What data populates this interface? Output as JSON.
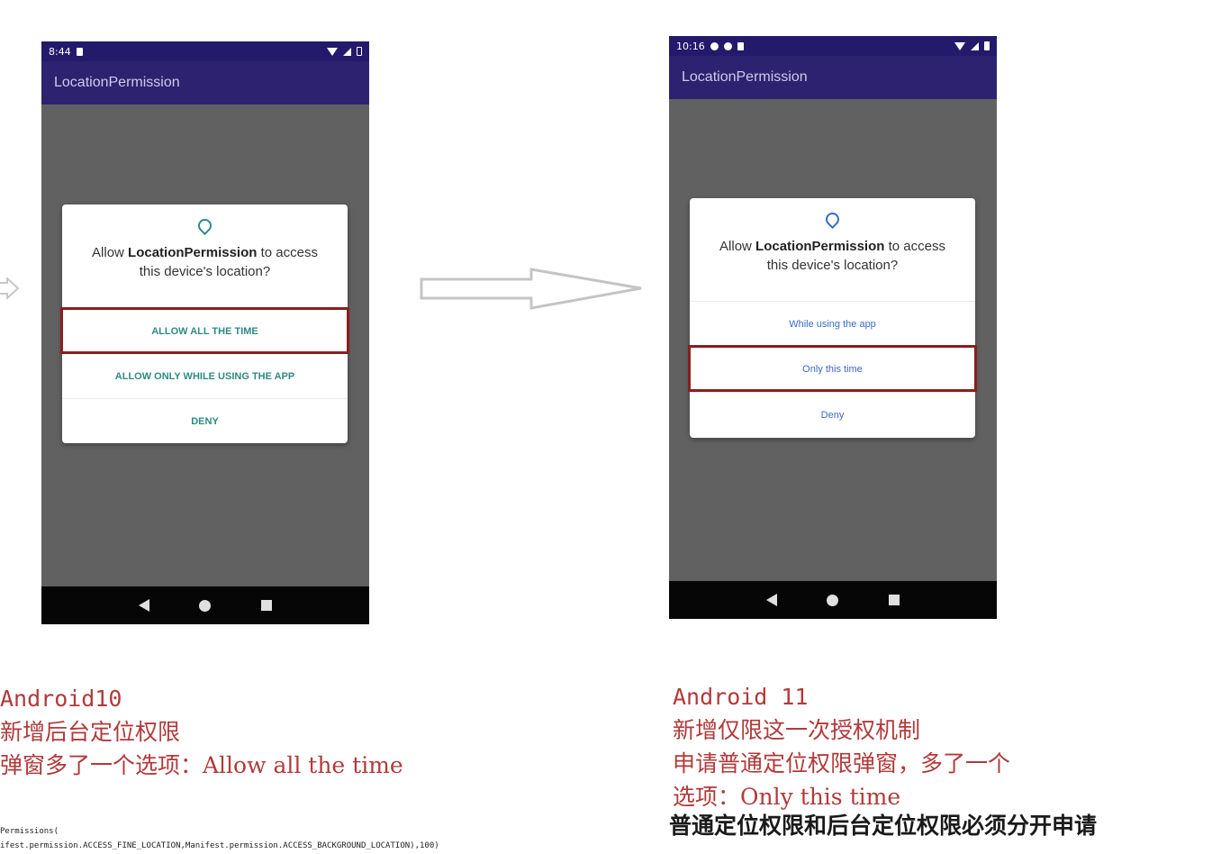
{
  "left_phone": {
    "status_time": "8:44",
    "app_title": "LocationPermission",
    "dialog": {
      "prefix": "Allow ",
      "app_name": "LocationPermission",
      "suffix": " to access this device's location?",
      "options": [
        "ALLOW ALL THE TIME",
        "ALLOW ONLY WHILE USING THE APP",
        "DENY"
      ],
      "highlighted_option": "ALLOW ALL THE TIME"
    }
  },
  "right_phone": {
    "status_time": "10:16",
    "app_title": "LocationPermission",
    "dialog": {
      "prefix": "Allow ",
      "app_name": "LocationPermission",
      "suffix": " to access this device's location?",
      "options": [
        "While using the app",
        "Only this time",
        "Deny"
      ],
      "highlighted_option": "Only this time"
    }
  },
  "captions": {
    "left": {
      "title": "Android10",
      "line1": "新增后台定位权限",
      "line2": "弹窗多了一个选项：Allow all the time"
    },
    "right": {
      "title": "Android 11",
      "line1": "新增仅限这一次授权机制",
      "line2": "申请普通定位权限弹窗，多了一个",
      "line3": "选项：Only this time",
      "line4": "普通定位权限和后台定位权限必须分开申请"
    }
  },
  "code": {
    "line1": "Permissions(",
    "line2": "ifest.permission.ACCESS_FINE_LOCATION,Manifest.permission.ACCESS_BACKGROUND_LOCATION),100)"
  },
  "colors": {
    "status_bar": "#231a6b",
    "app_bar": "#2c2270",
    "screen_bg": "#616161",
    "highlight_border": "#8a1f1f",
    "caption_red": "#b23a3a",
    "teal_button": "#2e8a83",
    "blue_button": "#3a6ac8"
  }
}
